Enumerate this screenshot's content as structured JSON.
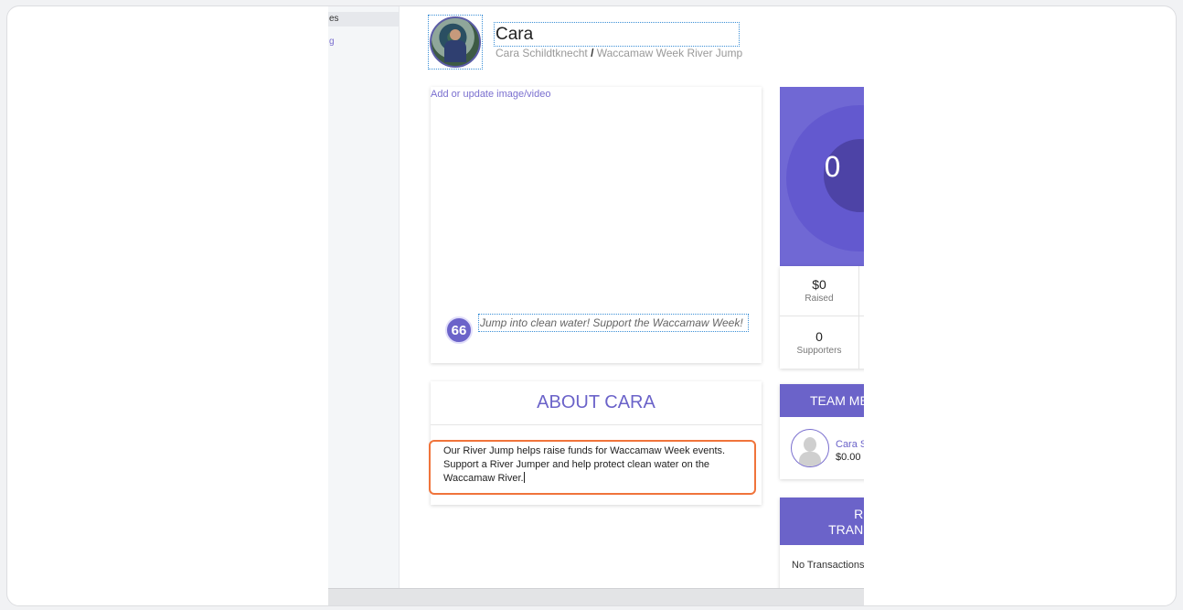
{
  "sidebar": {
    "items": [
      {
        "label": "es"
      },
      {
        "label": "g"
      }
    ]
  },
  "profile": {
    "name": "Cara",
    "owner": "Cara Schildtknecht",
    "separator": "/",
    "event": "Waccamaw Week River Jump"
  },
  "media": {
    "add_label": "Add or update image/video",
    "quote_glyph": "66",
    "tagline": "Jump into clean water! Support the Waccamaw Week!"
  },
  "about": {
    "title": "ABOUT CARA",
    "text": "Our River Jump helps raise funds for Waccamaw Week events. Support a River Jumper and help protect clean water on the Waccamaw River."
  },
  "progress": {
    "value_text": "0",
    "colors": {
      "accent": "#6b63c9",
      "highlight": "#f0743b"
    }
  },
  "stats": {
    "raised_value": "$0",
    "raised_label": "Raised",
    "supporters_value": "0",
    "supporters_label": "Supporters"
  },
  "team": {
    "heading": "TEAM ME",
    "member_name": "Cara S",
    "member_amount": "$0.00"
  },
  "transactions": {
    "heading_line1": "RECE",
    "heading_line2": "TRANSAC",
    "empty_text": "No Transactions"
  }
}
